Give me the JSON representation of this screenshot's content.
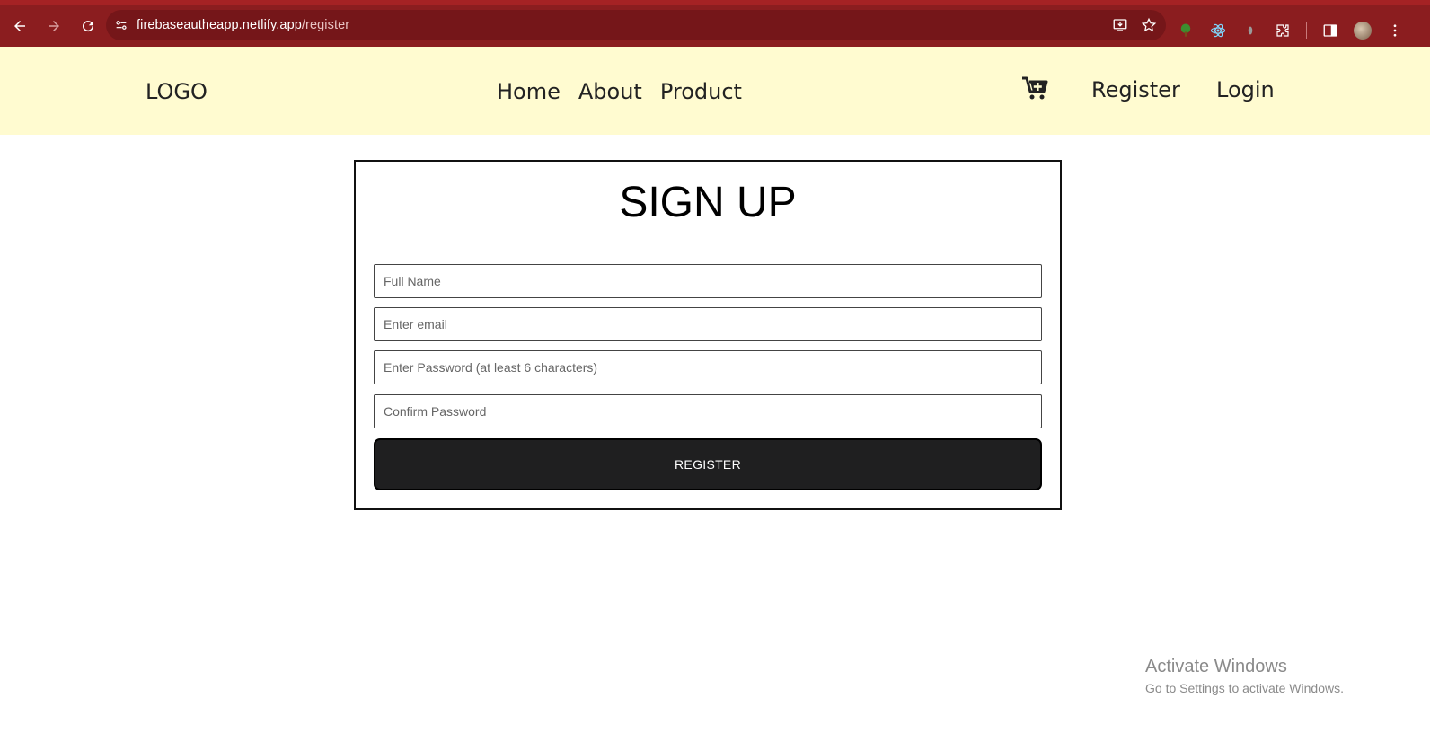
{
  "browser": {
    "url_host": "firebaseautheapp.netlify.app",
    "url_path": "/register"
  },
  "header": {
    "logo": "LOGO",
    "nav": [
      "Home",
      "About",
      "Product"
    ],
    "register_link": "Register",
    "login_link": "Login"
  },
  "form": {
    "title": "SIGN UP",
    "fields": [
      {
        "placeholder": "Full Name",
        "type": "text"
      },
      {
        "placeholder": "Enter email",
        "type": "email"
      },
      {
        "placeholder": "Enter Password (at least 6 characters)",
        "type": "password"
      },
      {
        "placeholder": "Confirm Password",
        "type": "password"
      }
    ],
    "submit_label": "REGISTER"
  },
  "watermark": {
    "title": "Activate Windows",
    "subtitle": "Go to Settings to activate Windows."
  },
  "colors": {
    "chrome_bg": "#8b1d1f",
    "header_bg": "#fffbd0",
    "button_bg": "#1f1f20"
  }
}
